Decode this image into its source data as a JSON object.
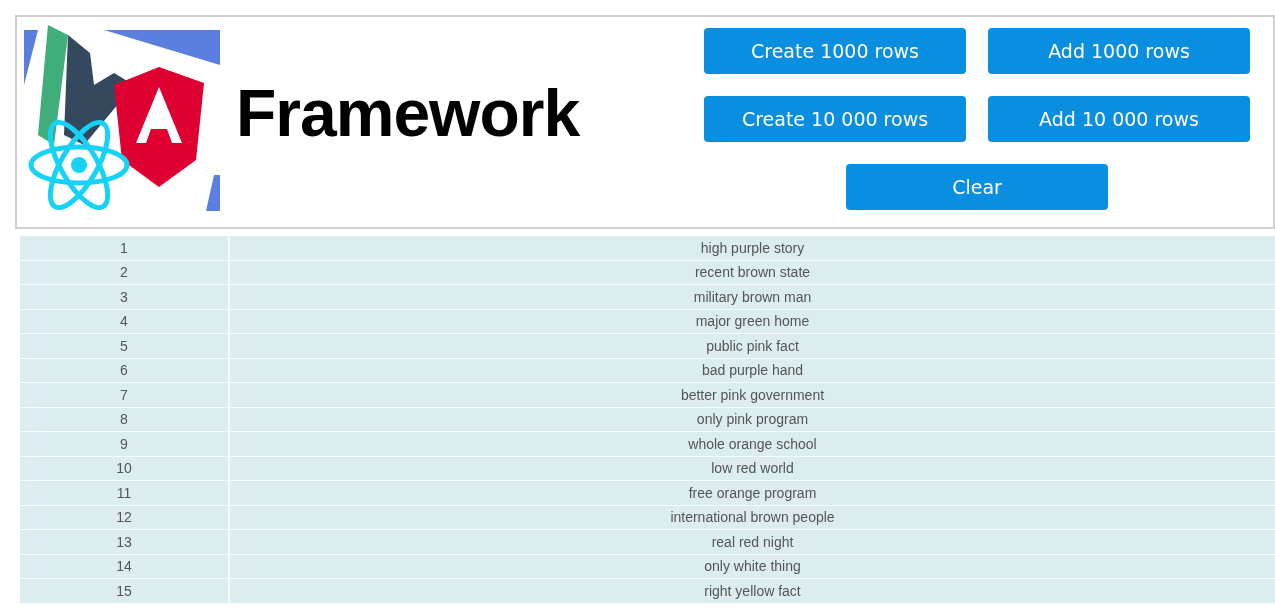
{
  "header": {
    "title": "Framework",
    "buttons": [
      {
        "label": "Create 1000 rows"
      },
      {
        "label": "Add 1000 rows"
      },
      {
        "label": "Create 10 000 rows"
      },
      {
        "label": "Add 10 000 rows"
      },
      {
        "label": "Clear"
      }
    ]
  },
  "table": {
    "rows": [
      {
        "id": "1",
        "label": "high purple story"
      },
      {
        "id": "2",
        "label": "recent brown state"
      },
      {
        "id": "3",
        "label": "military brown man"
      },
      {
        "id": "4",
        "label": "major green home"
      },
      {
        "id": "5",
        "label": "public pink fact"
      },
      {
        "id": "6",
        "label": "bad purple hand"
      },
      {
        "id": "7",
        "label": "better pink government"
      },
      {
        "id": "8",
        "label": "only pink program"
      },
      {
        "id": "9",
        "label": "whole orange school"
      },
      {
        "id": "10",
        "label": "low red world"
      },
      {
        "id": "11",
        "label": "free orange program"
      },
      {
        "id": "12",
        "label": "international brown people"
      },
      {
        "id": "13",
        "label": "real red night"
      },
      {
        "id": "14",
        "label": "only white thing"
      },
      {
        "id": "15",
        "label": "right yellow fact"
      }
    ]
  }
}
